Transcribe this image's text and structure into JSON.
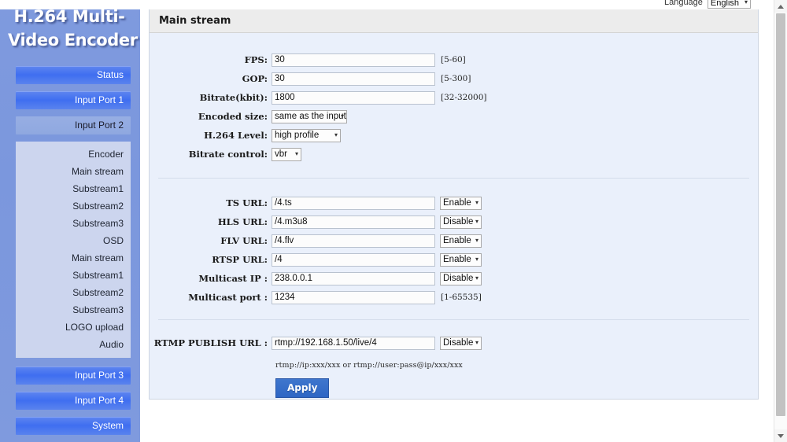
{
  "topbar": {
    "language_label": "Language",
    "language_value": "English"
  },
  "sidebar": {
    "brand_line1": "H.264 Multi-",
    "brand_line2": "Video Encoder",
    "top_items": [
      {
        "label": "Status",
        "active": false
      },
      {
        "label": "Input Port 1",
        "active": false
      },
      {
        "label": "Input Port 2",
        "active": true
      }
    ],
    "sub_items": [
      {
        "label": "Encoder"
      },
      {
        "label": "Main stream"
      },
      {
        "label": "Substream1"
      },
      {
        "label": "Substream2"
      },
      {
        "label": "Substream3"
      },
      {
        "label": "OSD"
      },
      {
        "label": "Main stream"
      },
      {
        "label": "Substream1"
      },
      {
        "label": "Substream2"
      },
      {
        "label": "Substream3"
      },
      {
        "label": "LOGO upload"
      },
      {
        "label": "Audio"
      }
    ],
    "bottom_items": [
      {
        "label": "Input Port 3"
      },
      {
        "label": "Input Port 4"
      },
      {
        "label": "System"
      }
    ]
  },
  "panel": {
    "title": "Main stream",
    "encoding": {
      "fps": {
        "label": "FPS:",
        "value": "30",
        "hint": "[5-60]"
      },
      "gop": {
        "label": "GOP:",
        "value": "30",
        "hint": "[5-300]"
      },
      "bitrate": {
        "label": "Bitrate(kbit):",
        "value": "1800",
        "hint": "[32-32000]"
      },
      "encoded_size": {
        "label": "Encoded size:",
        "value": "same as the input"
      },
      "h264_level": {
        "label": "H.264 Level:",
        "value": "high profile"
      },
      "bitrate_control": {
        "label": "Bitrate control:",
        "value": "vbr"
      }
    },
    "urls": {
      "ts": {
        "label": "TS URL:",
        "value": "/4.ts",
        "state": "Enable"
      },
      "hls": {
        "label": "HLS URL:",
        "value": "/4.m3u8",
        "state": "Disable"
      },
      "flv": {
        "label": "FLV URL:",
        "value": "/4.flv",
        "state": "Enable"
      },
      "rtsp": {
        "label": "RTSP URL:",
        "value": "/4",
        "state": "Enable"
      },
      "multicast_ip": {
        "label": "Multicast IP :",
        "value": "238.0.0.1",
        "state": "Disable"
      },
      "multicast_port": {
        "label": "Multicast port :",
        "value": "1234",
        "hint": "[1-65535]"
      }
    },
    "rtmp": {
      "label": "RTMP PUBLISH URL :",
      "value": "rtmp://192.168.1.50/live/4",
      "state": "Disable",
      "note": "rtmp://ip:xxx/xxx or rtmp://user:pass@ip/xxx/xxx"
    },
    "apply_label": "Apply"
  },
  "icons": {
    "caret": "▾"
  },
  "colors": {
    "sidebar_bg": "#7f9ade",
    "nav_blue": "#3f6ef0",
    "panel_bg": "#eaf0fb",
    "apply_blue": "#2e66c4"
  }
}
